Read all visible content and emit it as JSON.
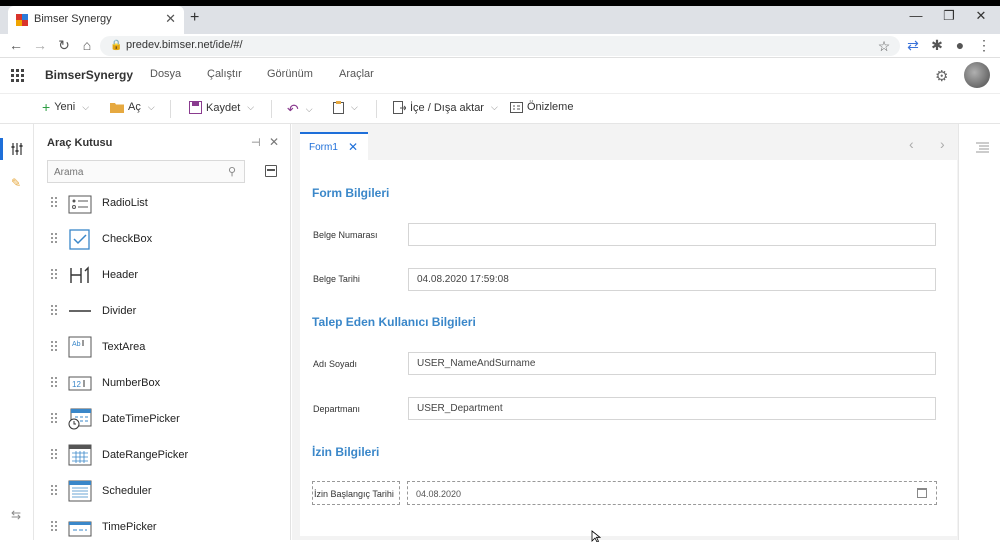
{
  "browser": {
    "tab_title": "Bimser Synergy",
    "tab_close": "✕",
    "new_tab": "+",
    "url": "predev.bimser.net/ide/#/",
    "window_minimize": "—",
    "window_restore": "❐",
    "window_close": "✕"
  },
  "app": {
    "brand": "BimserSynergy",
    "menu": [
      "Dosya",
      "Çalıştır",
      "Görünüm",
      "Araçlar"
    ]
  },
  "toolbar": {
    "new_label": "Yeni",
    "open_label": "Aç",
    "save_label": "Kaydet",
    "import_export_label": "İçe / Dışa aktar",
    "preview_label": "Önizleme"
  },
  "toolbox": {
    "title": "Araç Kutusu",
    "search_placeholder": "Arama",
    "items": [
      {
        "label": "RadioList",
        "icon": "radio-list-icon"
      },
      {
        "label": "CheckBox",
        "icon": "checkbox-icon"
      },
      {
        "label": "Header",
        "icon": "header-h1-icon"
      },
      {
        "label": "Divider",
        "icon": "divider-icon"
      },
      {
        "label": "TextArea",
        "icon": "textarea-icon"
      },
      {
        "label": "NumberBox",
        "icon": "numberbox-icon"
      },
      {
        "label": "DateTimePicker",
        "icon": "datetimepicker-icon"
      },
      {
        "label": "DateRangePicker",
        "icon": "daterangepicker-icon"
      },
      {
        "label": "Scheduler",
        "icon": "scheduler-icon"
      },
      {
        "label": "TimePicker",
        "icon": "timepicker-icon"
      }
    ]
  },
  "editor": {
    "tab_label": "Form1",
    "tab_close": "✕",
    "form": {
      "section1": "Form Bilgileri",
      "doc_number_label": "Belge Numarası",
      "doc_number_value": "",
      "doc_date_label": "Belge Tarihi",
      "doc_date_value": "04.08.2020 17:59:08",
      "section2": "Talep Eden Kullanıcı Bilgileri",
      "name_label": "Adı Soyadı",
      "name_value": "USER_NameAndSurname",
      "dept_label": "Departmanı",
      "dept_value": "USER_Department",
      "section3": "İzin Bilgileri",
      "leave_start_label": "İzin Başlangıç Tarihi",
      "leave_start_value": "04.08.2020"
    }
  },
  "colors": {
    "accent": "#1e6fd9",
    "section_title": "#3a87c9"
  }
}
